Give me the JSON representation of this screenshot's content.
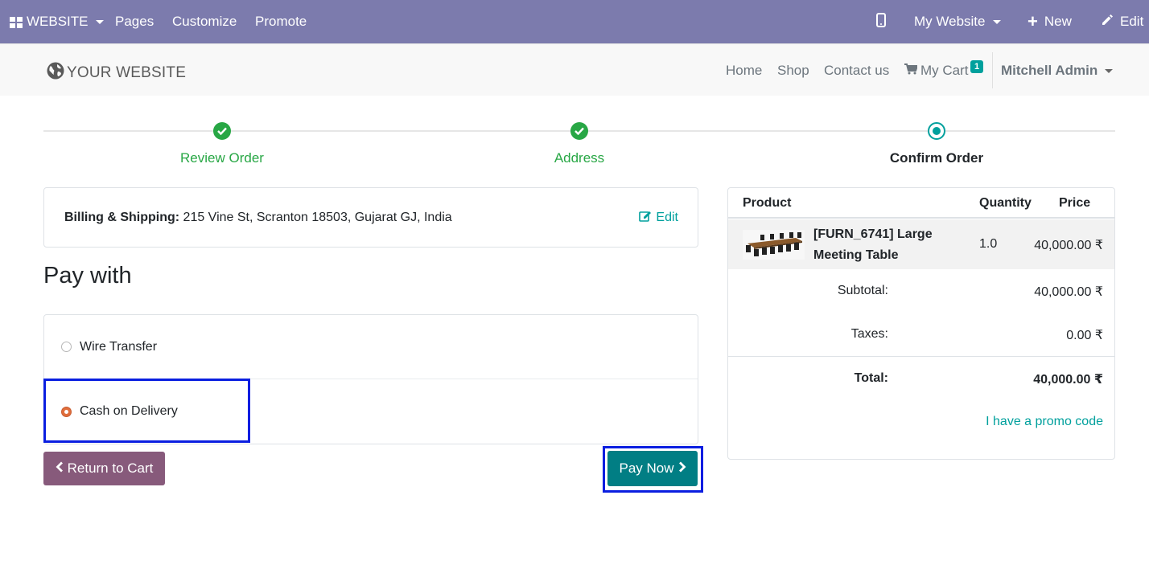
{
  "admin_bar": {
    "website_label": "WEBSITE",
    "pages_label": "Pages",
    "customize_label": "Customize",
    "promote_label": "Promote",
    "mobile_icon": "mobile-icon",
    "my_website_label": "My Website",
    "new_label": "New",
    "edit_label": "Edit"
  },
  "header": {
    "logo_text": "YOUR WEBSITE",
    "nav": {
      "home": "Home",
      "shop": "Shop",
      "contact": "Contact us",
      "cart": "My Cart",
      "cart_count": "1"
    },
    "user_name": "Mitchell Admin"
  },
  "steps": [
    {
      "label": "Review Order",
      "status": "done"
    },
    {
      "label": "Address",
      "status": "done"
    },
    {
      "label": "Confirm Order",
      "status": "current"
    }
  ],
  "billing": {
    "label": "Billing & Shipping:",
    "address": " 215 Vine St, Scranton 18503, Gujarat GJ, India",
    "edit_label": "Edit"
  },
  "pay_with_title": "Pay with",
  "payment_methods": [
    {
      "label": "Wire Transfer",
      "selected": false
    },
    {
      "label": "Cash on Delivery",
      "selected": true
    }
  ],
  "buttons": {
    "return_label": "Return to Cart",
    "pay_label": "Pay Now"
  },
  "summary": {
    "headers": {
      "product": "Product",
      "quantity": "Quantity",
      "price": "Price"
    },
    "items": [
      {
        "name": "[FURN_6741] Large Meeting Table",
        "quantity": "1.0",
        "price": "40,000.00 ₹"
      }
    ],
    "subtotal_label": "Subtotal:",
    "subtotal_value": "40,000.00 ₹",
    "taxes_label": "Taxes:",
    "taxes_value": "0.00 ₹",
    "total_label": "Total:",
    "total_value": "40,000.00 ₹",
    "promo_label": "I have a promo code"
  },
  "colors": {
    "admin_bar": "#7c7bad",
    "accent": "#00a09d",
    "success": "#28a745",
    "return_button": "#875a7b",
    "pay_button": "#017e84",
    "highlight": "#0a1ee0"
  }
}
